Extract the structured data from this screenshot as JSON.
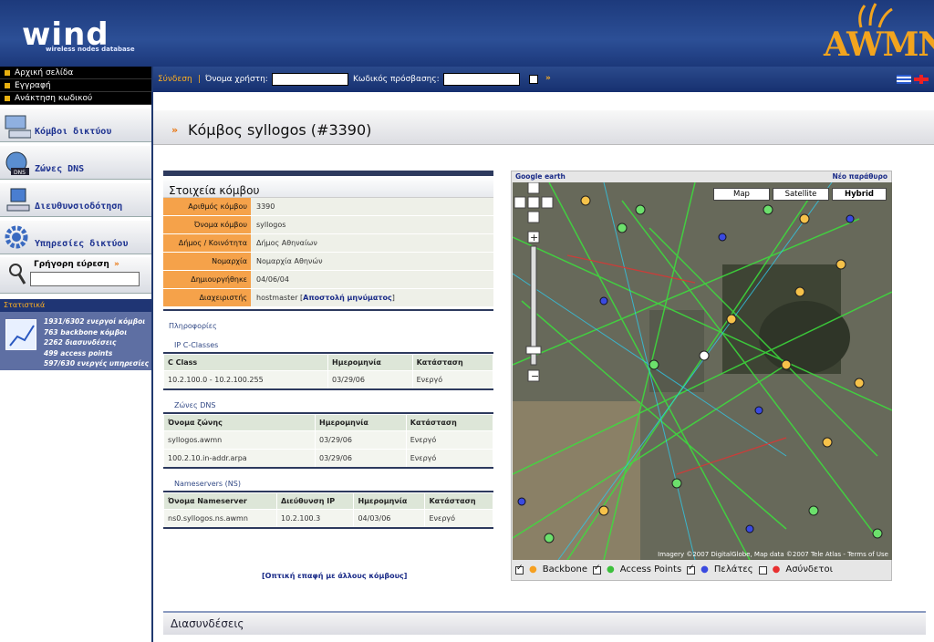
{
  "header": {
    "logo": "wind",
    "logo_sub": "wireless nodes database",
    "brand": "AWMN"
  },
  "sidebar": {
    "top_links": [
      "Αρχική σελίδα",
      "Εγγραφή",
      "Ανάκτηση κωδικού"
    ],
    "nav": [
      {
        "label": "Κόμβοι δικτύου",
        "icon": "computer-icon"
      },
      {
        "label": "Ζώνες DNS",
        "icon": "globe-dns-icon"
      },
      {
        "label": "Διευθυνσιοδότηση",
        "icon": "pc-icon"
      },
      {
        "label": "Υπηρεσίες δικτύου",
        "icon": "gear-icon"
      }
    ],
    "quick_search": "Γρήγορη εύρεση",
    "stats": {
      "title": "Στατιστικά",
      "lines": [
        "1931/6302 ενεργοί κόμβοι",
        "763 backbone κόμβοι",
        "2262 διασυνδέσεις",
        "499 access points",
        "597/630 ενεργές υπηρεσίες"
      ]
    }
  },
  "topbar": {
    "login": "Σύνδεση",
    "username_label": "Όνομα χρήστη:",
    "password_label": "Κωδικός πρόσβασης:"
  },
  "page": {
    "title": "Κόμβος syllogos (#3390)"
  },
  "info": {
    "title": "Στοιχεία κόμβου",
    "rows": [
      {
        "k": "Αριθμός κόμβου",
        "v": "3390"
      },
      {
        "k": "Όνομα κόμβου",
        "v": "syllogos"
      },
      {
        "k": "Δήμος / Κοινότητα",
        "v": "Δήμος Αθηναίων"
      },
      {
        "k": "Νομαρχία",
        "v": "Νομαρχία Αθηνών"
      },
      {
        "k": "Δημιουργήθηκε",
        "v": "04/06/04"
      },
      {
        "k": "Διαχειριστής",
        "v": "hostmaster",
        "link": "Αποστολή μηνύματος"
      }
    ],
    "info_label": "Πληροφορίες",
    "ip_title": "IP C-Classes",
    "ip_headers": [
      "C Class",
      "Ημερομηνία",
      "Κατάσταση"
    ],
    "ip_rows": [
      [
        "10.2.100.0 - 10.2.100.255",
        "03/29/06",
        "Ενεργό"
      ]
    ],
    "dns_title": "Ζώνες DNS",
    "dns_headers": [
      "Όνομα ζώνης",
      "Ημερομηνία",
      "Κατάσταση"
    ],
    "dns_rows": [
      [
        "syllogos.awmn",
        "03/29/06",
        "Ενεργό"
      ],
      [
        "100.2.10.in-addr.arpa",
        "03/29/06",
        "Ενεργό"
      ]
    ],
    "ns_title": "Nameservers (NS)",
    "ns_headers": [
      "Όνομα Nameserver",
      "Διεύθυνση IP",
      "Ημερομηνία",
      "Κατάσταση"
    ],
    "ns_rows": [
      [
        "ns0.syllogos.ns.awmn",
        "10.2.100.3",
        "04/03/06",
        "Ενεργό"
      ]
    ],
    "optical": "Οπτική επαφή με άλλους κόμβους"
  },
  "map": {
    "google_earth": "Google earth",
    "new_window": "Νέο παράθυρο",
    "types": [
      "Map",
      "Satellite",
      "Hybrid"
    ],
    "credits": "Imagery ©2007 DigitalGlobe, Map data ©2007 Tele Atlas - Terms of Use",
    "legend": [
      "Backbone",
      "Access Points",
      "Πελάτες",
      "Ασύνδετοι"
    ]
  },
  "links_bar": {
    "title": "Διασυνδέσεις"
  },
  "colors": {
    "accent": "#f5a24a",
    "nav_text": "#1d3290",
    "header": "#1d3a7c"
  }
}
